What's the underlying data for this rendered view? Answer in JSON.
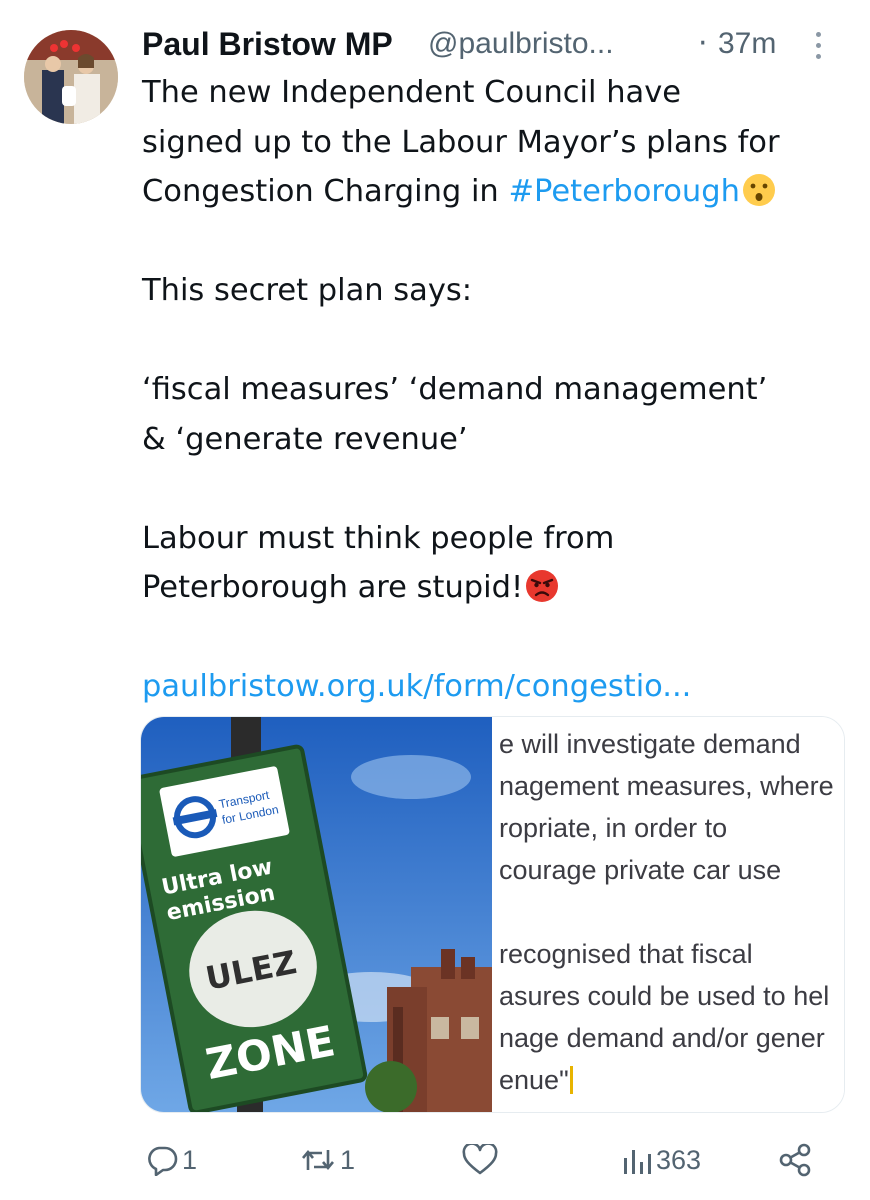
{
  "tweet": {
    "author_name": "Paul Bristow MP",
    "handle": "@paulbristo...",
    "separator": "·",
    "time": "37m",
    "lines": [
      "The new Independent Council have",
      "signed up to the Labour Mayor’s plans for",
      "Congestion Charging in"
    ],
    "hashtag": "#Peterborough",
    "para2": "This secret plan says:",
    "para3_line1": "‘fiscal measures’ ‘demand management’",
    "para3_line2": "& ‘generate revenue’",
    "para4_line1": "Labour must think people from",
    "para4_line2": "Peterborough are stupid!",
    "link": "paulbristow.org.uk/form/congestio..."
  },
  "card": {
    "sign": {
      "brand_line1": "Transport",
      "brand_line2": "for London",
      "line1": "Ultra low",
      "line2": "emission",
      "badge": "ULEZ",
      "zone": "ZONE"
    },
    "doc_lines": [
      "e will investigate demand",
      "nagement measures, where",
      "ropriate, in order to",
      "courage private car use",
      "",
      "recognised that fiscal",
      "asures could be used to hel",
      "nage demand and/or gener",
      "enue\""
    ]
  },
  "actions": {
    "reply_count": "1",
    "retweet_count": "1",
    "like_count": "",
    "views_count": "363"
  },
  "colors": {
    "link": "#1d9bf0",
    "secondary": "#536471",
    "sign_green": "#2e6b36",
    "sky": "#3f7fd2"
  }
}
